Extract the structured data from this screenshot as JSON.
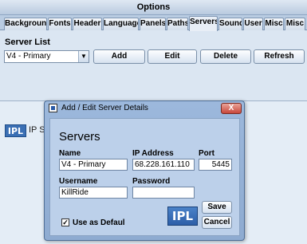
{
  "window": {
    "title": "Options"
  },
  "tabs": [
    {
      "label": "Background"
    },
    {
      "label": "Fonts"
    },
    {
      "label": "Header"
    },
    {
      "label": "Language"
    },
    {
      "label": "Panels"
    },
    {
      "label": "Paths"
    },
    {
      "label": "Servers"
    },
    {
      "label": "Sound"
    },
    {
      "label": "User"
    },
    {
      "label": "Misc"
    },
    {
      "label": "Misc"
    }
  ],
  "active_tab": "Servers",
  "server_list": {
    "label": "Server List",
    "selected": "V4 - Primary",
    "buttons": {
      "add": "Add",
      "edit": "Edit",
      "delete": "Delete",
      "refresh": "Refresh"
    }
  },
  "background": {
    "logo": "IPL",
    "partial_text": "IP Se"
  },
  "dialog": {
    "title": "Add / Edit Server Details",
    "close": "X",
    "heading": "Servers",
    "fields": {
      "name_label": "Name",
      "name_value": "V4 - Primary",
      "ip_label": "IP Address",
      "ip_value": "68.228.161.110",
      "port_label": "Port",
      "port_value": "5445",
      "username_label": "Username",
      "username_value": "KillRide",
      "password_label": "Password",
      "password_value": ""
    },
    "use_default_label": "Use as Defaul",
    "use_default_checked": "✓",
    "logo": "IPL",
    "save": "Save",
    "cancel": "Cancel"
  },
  "colors": {
    "accent": "#3a6fb4",
    "dialog": "#9cb8dc",
    "close": "#c8463a"
  }
}
